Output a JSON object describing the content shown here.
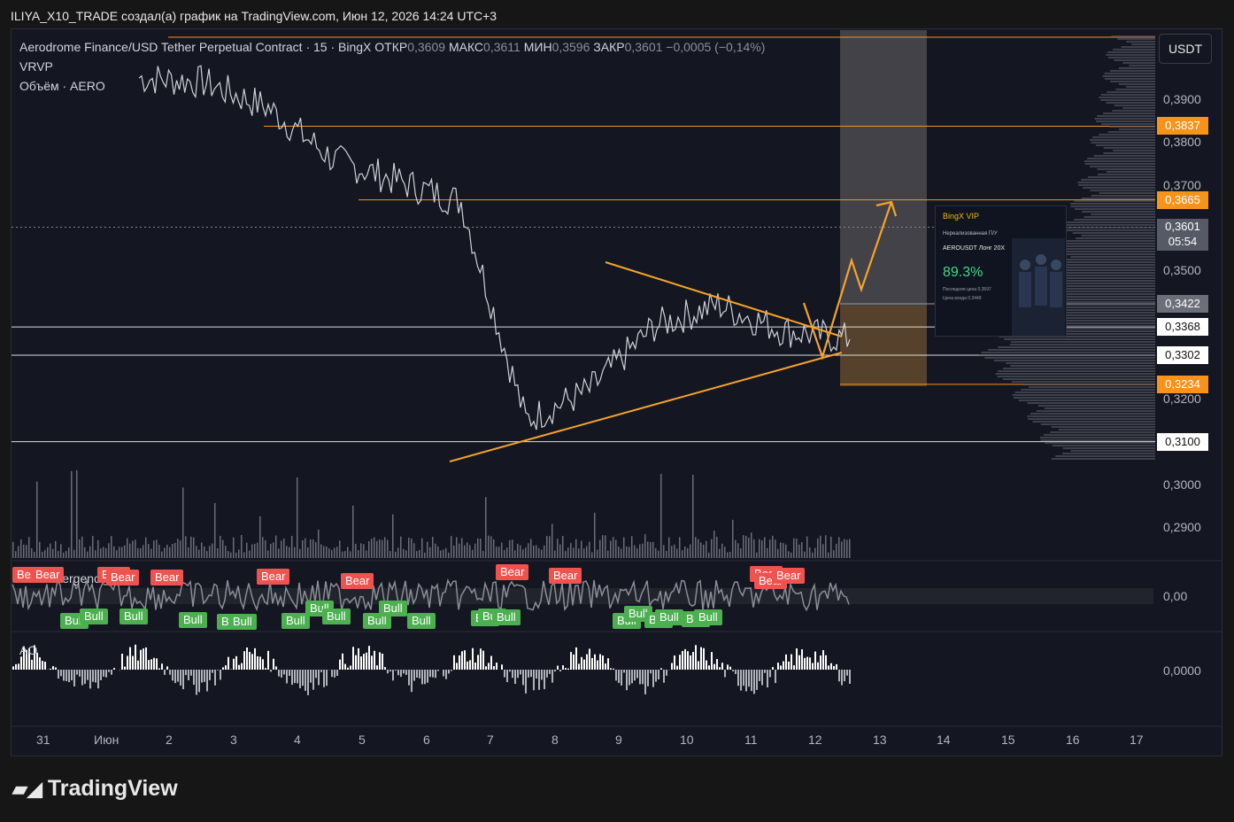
{
  "topbar": {
    "text": "ILIYA_X10_TRADE создал(а) график на TradingView.com, Июн 12, 2026 14:24 UTC+3"
  },
  "legend": {
    "symbol": "Aerodrome Finance/USD Tether Perpetual Contract · 15 · BingX",
    "open_label": "ОТКР",
    "open": "0,3609",
    "high_label": "МАКС",
    "high": "0,3611",
    "low_label": "МИН",
    "low": "0,3596",
    "close_label": "ЗАКР",
    "close": "0,3601",
    "change": "−0,0005 (−0,14%)",
    "ind1": "VRVP",
    "ind2": "Объём · AERO"
  },
  "currency": "USDT",
  "price_axis": [
    "0,3900",
    "0,3800",
    "0,3700",
    "0,3500",
    "0,3200",
    "0,3000",
    "0,2900"
  ],
  "price_tags": [
    {
      "text": "0,3837",
      "color": "#f7931a"
    },
    {
      "text": "0,3665",
      "color": "#f7931a"
    },
    {
      "text": "0,3601",
      "sub": "05:54",
      "color": "#555a66"
    },
    {
      "text": "0,3422",
      "color": "#6b6f7a"
    },
    {
      "text": "0,3368",
      "color": "#ffffff"
    },
    {
      "text": "0,3302",
      "color": "#ffffff"
    },
    {
      "text": "0,3234",
      "color": "#f7931a"
    },
    {
      "text": "0,3100",
      "color": "#ffffff"
    }
  ],
  "osc": {
    "label": "Divergence",
    "zero": "0,00"
  },
  "ao": {
    "label": "AO",
    "zero": "0,0000"
  },
  "time_axis": [
    "31",
    "Июн",
    "2",
    "3",
    "4",
    "5",
    "6",
    "7",
    "8",
    "9",
    "10",
    "11",
    "12",
    "13",
    "14",
    "15",
    "16",
    "17"
  ],
  "signals": {
    "bear": [
      "Bear",
      "Bear",
      "Bear",
      "Bear",
      "Bear",
      "Bear",
      "Bear",
      "Bear",
      "Bear",
      "Bear",
      "Bear",
      "Bear"
    ],
    "bull": [
      "Bull",
      "Bull",
      "Bull",
      "Bull",
      "Bull",
      "Bull",
      "Bull",
      "Bull",
      "Bull",
      "Bull",
      "Bull",
      "Bull",
      "Bull",
      "Bull",
      "Bull",
      "Bull",
      "Bull",
      "Bull",
      "Bull",
      "Bull",
      "Bull"
    ]
  },
  "promo": {
    "brand": "BingX VIP",
    "sub": "Нереализованная П/У",
    "pair": "AEROUSDT  Лонг  20X",
    "pct": "89.3%",
    "last": "Последняя цена  0.3597",
    "entry": "Цена входа  0.3449"
  },
  "brand": "TradingView",
  "colors": {
    "accent": "#f7931a",
    "bull": "#4caf50",
    "bear": "#ef5350",
    "bg": "#141722"
  },
  "chart_data": {
    "type": "line",
    "title": "Aerodrome Finance/USD Tether Perpetual Contract · 15 · BingX",
    "xlabel": "",
    "ylabel": "",
    "x": [
      "31",
      "Июн",
      "2",
      "3",
      "4",
      "5",
      "6",
      "7",
      "8",
      "9",
      "10",
      "11",
      "12"
    ],
    "series": [
      {
        "name": "",
        "values": [
          0.395,
          0.394,
          0.388,
          0.376,
          0.371,
          0.366,
          0.315,
          0.322,
          0.337,
          0.342,
          0.336,
          0.334,
          0.36
        ]
      }
    ],
    "ylim": [
      0.285,
      0.395
    ],
    "grid": false,
    "levels": [
      0.3837,
      0.3665,
      0.3422,
      0.3368,
      0.3302,
      0.3234,
      0.31
    ],
    "last_price": 0.3601
  }
}
